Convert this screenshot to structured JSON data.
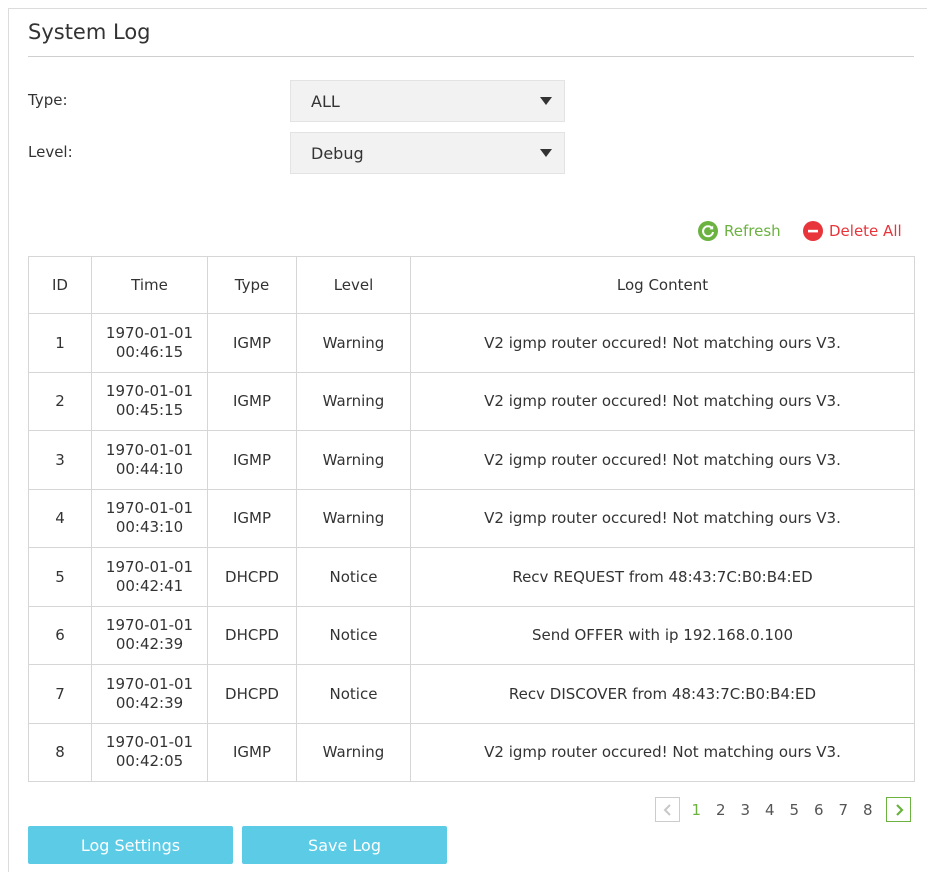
{
  "page": {
    "title": "System Log"
  },
  "filters": {
    "type_label": "Type:",
    "type_value": "ALL",
    "level_label": "Level:",
    "level_value": "Debug"
  },
  "actions": {
    "refresh_label": "Refresh",
    "delete_all_label": "Delete All"
  },
  "table": {
    "headers": [
      "ID",
      "Time",
      "Type",
      "Level",
      "Log Content"
    ],
    "rows": [
      {
        "id": "1",
        "date": "1970-01-01",
        "time": "00:46:15",
        "type": "IGMP",
        "level": "Warning",
        "content": "V2 igmp router occured! Not matching ours V3."
      },
      {
        "id": "2",
        "date": "1970-01-01",
        "time": "00:45:15",
        "type": "IGMP",
        "level": "Warning",
        "content": "V2 igmp router occured! Not matching ours V3."
      },
      {
        "id": "3",
        "date": "1970-01-01",
        "time": "00:44:10",
        "type": "IGMP",
        "level": "Warning",
        "content": "V2 igmp router occured! Not matching ours V3."
      },
      {
        "id": "4",
        "date": "1970-01-01",
        "time": "00:43:10",
        "type": "IGMP",
        "level": "Warning",
        "content": "V2 igmp router occured! Not matching ours V3."
      },
      {
        "id": "5",
        "date": "1970-01-01",
        "time": "00:42:41",
        "type": "DHCPD",
        "level": "Notice",
        "content": "Recv REQUEST from 48:43:7C:B0:B4:ED"
      },
      {
        "id": "6",
        "date": "1970-01-01",
        "time": "00:42:39",
        "type": "DHCPD",
        "level": "Notice",
        "content": "Send OFFER with ip 192.168.0.100"
      },
      {
        "id": "7",
        "date": "1970-01-01",
        "time": "00:42:39",
        "type": "DHCPD",
        "level": "Notice",
        "content": "Recv DISCOVER from 48:43:7C:B0:B4:ED"
      },
      {
        "id": "8",
        "date": "1970-01-01",
        "time": "00:42:05",
        "type": "IGMP",
        "level": "Warning",
        "content": "V2 igmp router occured! Not matching ours V3."
      }
    ]
  },
  "pagination": {
    "pages": [
      "1",
      "2",
      "3",
      "4",
      "5",
      "6",
      "7",
      "8"
    ],
    "current": "1"
  },
  "buttons": {
    "log_settings": "Log Settings",
    "save_log": "Save Log"
  },
  "colors": {
    "accent_green": "#6bb240",
    "delete_red": "#e8353b",
    "button_blue": "#5bcbe6"
  }
}
